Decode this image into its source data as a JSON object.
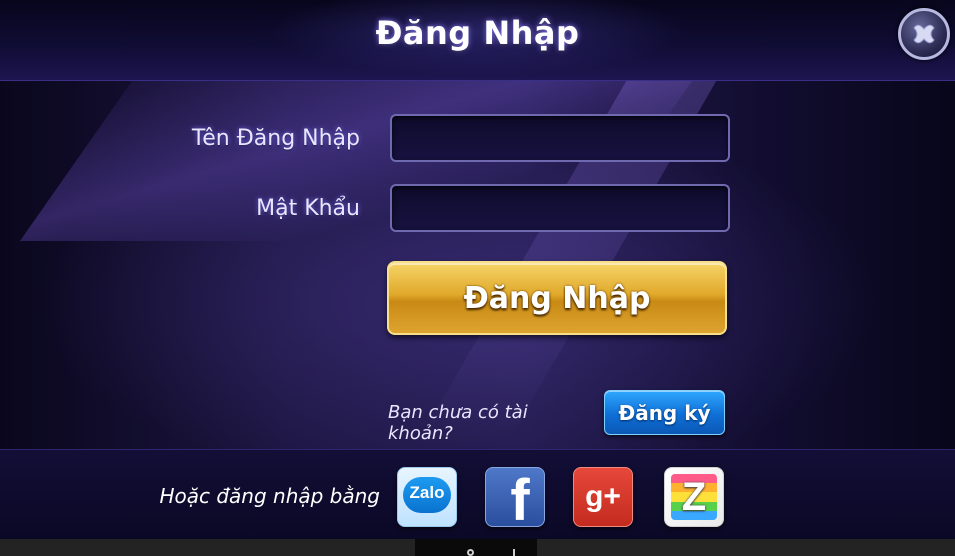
{
  "header": {
    "title": "Đăng Nhập",
    "close_icon": "close-x-icon"
  },
  "form": {
    "username_label": "Tên Đăng Nhập",
    "username_value": "",
    "password_label": "Mật Khẩu",
    "password_value": "",
    "login_button": "Đăng Nhập"
  },
  "register": {
    "prompt": "Bạn chưa có tài khoản?",
    "button": "Đăng ký"
  },
  "social": {
    "prompt": "Hoặc đăng nhập bằng",
    "providers": [
      {
        "icon": "zalo-icon",
        "label": "Zalo",
        "color": "#0a73cf"
      },
      {
        "icon": "facebook-icon",
        "label": "f",
        "color": "#3b5998"
      },
      {
        "icon": "google-plus-icon",
        "label": "g+",
        "color": "#dd4b39"
      },
      {
        "icon": "z-app-icon",
        "label": "Z",
        "color": "#ffffff"
      }
    ]
  },
  "colors": {
    "login_gold": "#e0a92b",
    "register_blue": "#0f6fd6",
    "background": "#1c1540"
  }
}
